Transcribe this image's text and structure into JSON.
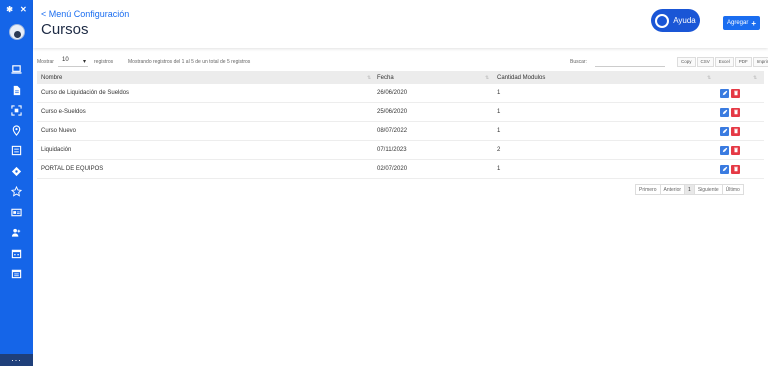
{
  "header": {
    "back_link": "< Menú Configuración",
    "title": "Cursos",
    "help_label": "Ayuda",
    "add_label": "Agregar"
  },
  "toolbar": {
    "show_label": "Mostrar",
    "length_value": "10",
    "records_label": "registros",
    "info": "Mostrando registros del 1 al 5 de un total de 5 registros",
    "search_label": "Buscar:",
    "search_value": "",
    "exports": [
      "Copy",
      "CSV",
      "Excel",
      "PDF",
      "Imprimir"
    ]
  },
  "table": {
    "columns": [
      "Nombre",
      "Fecha",
      "Cantidad Modulos"
    ],
    "rows": [
      [
        "Curso de Liquidación de Sueldos",
        "26/06/2020",
        "1"
      ],
      [
        "Curso e-Sueldos",
        "25/06/2020",
        "1"
      ],
      [
        "Curso Nuevo",
        "08/07/2022",
        "1"
      ],
      [
        "Liquidación",
        "07/11/2023",
        "2"
      ],
      [
        "PORTAL DE EQUIPOS",
        "02/07/2020",
        "1"
      ]
    ]
  },
  "pagination": {
    "first": "Primero",
    "prev": "Anterior",
    "current": "1",
    "next": "Siguiente",
    "last": "Último"
  },
  "colors": {
    "sidebar": "#1565e8",
    "accent": "#1a6df0",
    "delete": "#e53945"
  },
  "sidebar_icons": [
    "laptop-icon",
    "document-icon",
    "scan-icon",
    "location-icon",
    "list-icon",
    "tag-icon",
    "star-icon",
    "id-card-icon",
    "users-icon",
    "calendar-icon",
    "calendar-check-icon"
  ]
}
